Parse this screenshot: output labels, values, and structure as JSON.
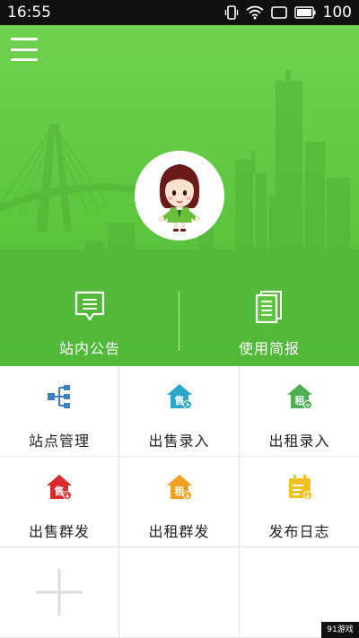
{
  "status_bar": {
    "time": "16:55",
    "battery": "100",
    "icons": [
      "vibrate-icon",
      "wifi-icon",
      "screen-icon",
      "battery-icon"
    ]
  },
  "header": {
    "menu_icon": "hamburger-menu-icon",
    "avatar_icon": "cartoon-girl-avatar",
    "actions": [
      {
        "label": "站内公告",
        "icon": "announcement-icon"
      },
      {
        "label": "使用简报",
        "icon": "report-document-icon"
      }
    ]
  },
  "grid": {
    "items": [
      {
        "label": "站点管理",
        "icon": "site-tree-icon",
        "color": "#3b7fc4"
      },
      {
        "label": "出售录入",
        "icon": "house-sale-icon",
        "color": "#2aa7c9"
      },
      {
        "label": "出租录入",
        "icon": "house-rent-icon",
        "color": "#4caf50"
      },
      {
        "label": "出售群发",
        "icon": "house-sale-broadcast-icon",
        "color": "#d92b2b"
      },
      {
        "label": "出租群发",
        "icon": "house-rent-broadcast-icon",
        "color": "#f0a020"
      },
      {
        "label": "发布日志",
        "icon": "calendar-log-icon",
        "color": "#f2c21c"
      }
    ],
    "add_icon": "plus-add-icon"
  },
  "colors": {
    "header_green": "#5cc63f",
    "status_bar": "#111111"
  },
  "watermark": "91游戏"
}
